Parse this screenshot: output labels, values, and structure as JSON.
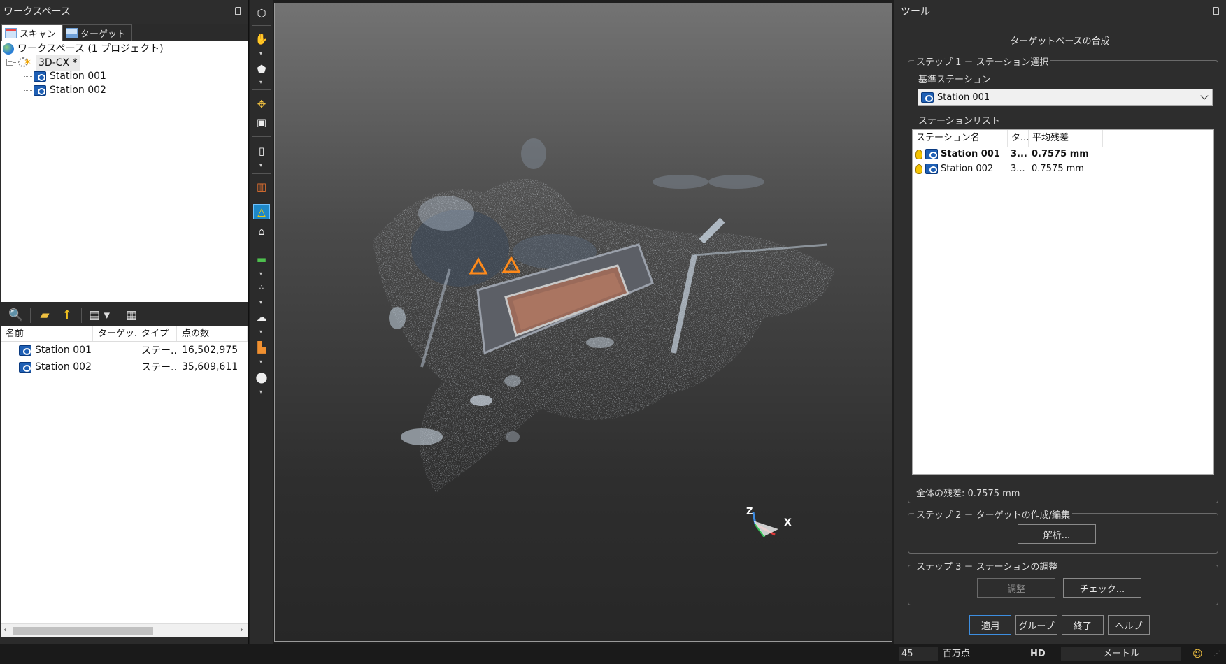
{
  "workspace": {
    "title": "ワークスペース",
    "tabs": [
      {
        "label": "スキャン",
        "active": true
      },
      {
        "label": "ターゲット",
        "active": false
      }
    ],
    "tree": {
      "root": "ワークスペース (1 プロジェクト)",
      "project": "3D-CX",
      "project_mark": "*",
      "stations": [
        "Station 001",
        "Station 002"
      ]
    },
    "list": {
      "columns": [
        "名前",
        "ターゲッ...",
        "タイプ",
        "点の数"
      ],
      "rows": [
        {
          "name": "Station 001",
          "target": "",
          "type": "ステー...",
          "points": "16,502,975"
        },
        {
          "name": "Station 002",
          "target": "",
          "type": "ステー...",
          "points": "35,609,611"
        }
      ]
    }
  },
  "tools": {
    "title": "ツール",
    "heading": "ターゲットベースの合成",
    "step1": {
      "legend": "ステップ 1 － ステーション選択",
      "base_label": "基準ステーション",
      "base_value": "Station 001",
      "list_label": "ステーションリスト",
      "columns": [
        "ステーション名",
        "タ...",
        "平均残差"
      ],
      "rows": [
        {
          "name": "Station 001",
          "t": "3...",
          "residual": "0.7575 mm",
          "bold": true
        },
        {
          "name": "Station 002",
          "t": "3...",
          "residual": "0.7575 mm",
          "bold": false
        }
      ],
      "total": "全体の残差: 0.7575 mm"
    },
    "step2": {
      "legend": "ステップ 2 － ターゲットの作成/編集",
      "analyze": "解析..."
    },
    "step3": {
      "legend": "ステップ 3 － ステーションの調整",
      "adjust": "調整",
      "check": "チェック..."
    },
    "buttons": {
      "apply": "適用",
      "group": "グループ",
      "close": "終了",
      "help": "ヘルプ"
    }
  },
  "viewport": {
    "axis_z": "Z",
    "axis_x": "X"
  },
  "status": {
    "value": "45",
    "unit": "百万点",
    "quality": "HD",
    "length_unit": "メートル"
  }
}
